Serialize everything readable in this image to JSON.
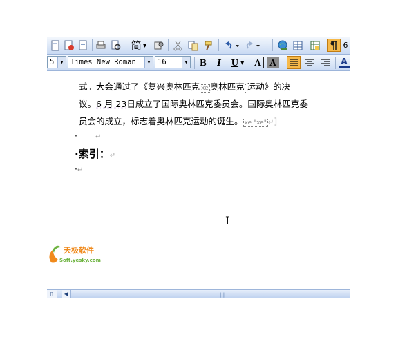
{
  "toolbar_standard": {
    "columns_label": "简",
    "partial_value": "6"
  },
  "toolbar_formatting": {
    "style_partial": "5 ¶",
    "font_name": "Times New Roman",
    "font_size": "16",
    "bold": "B",
    "italic": "I",
    "underline": "U",
    "char_border": "A",
    "char_shading": "A",
    "font_color": "A"
  },
  "document": {
    "line1_a": "式。大会通过了《复兴奥林匹克",
    "line1_field1": "xe",
    "line1_b": "奥林匹克",
    "line1_field2": "",
    "line1_c": "运动》的决",
    "line2_a": "议。",
    "line2_date": "6 月 23",
    "line2_b": "日成立了国际奥林匹克委员会。国际奥林匹克委",
    "line3_a": "员会的成立，标志着奥林匹克运动的诞生。",
    "line3_field": "xe \"xe\"",
    "heading": "索引：",
    "para_mark": "↵",
    "bullet": "·"
  },
  "watermark": {
    "cn": "天极软件",
    "en": "Soft.yesky.com"
  },
  "colors": {
    "toolbar_top": "#f4f8fd",
    "toolbar_bottom": "#c9daf3",
    "active_button": "#f6b94a",
    "logo_orange": "#f08a1c",
    "logo_green": "#6db33f"
  }
}
